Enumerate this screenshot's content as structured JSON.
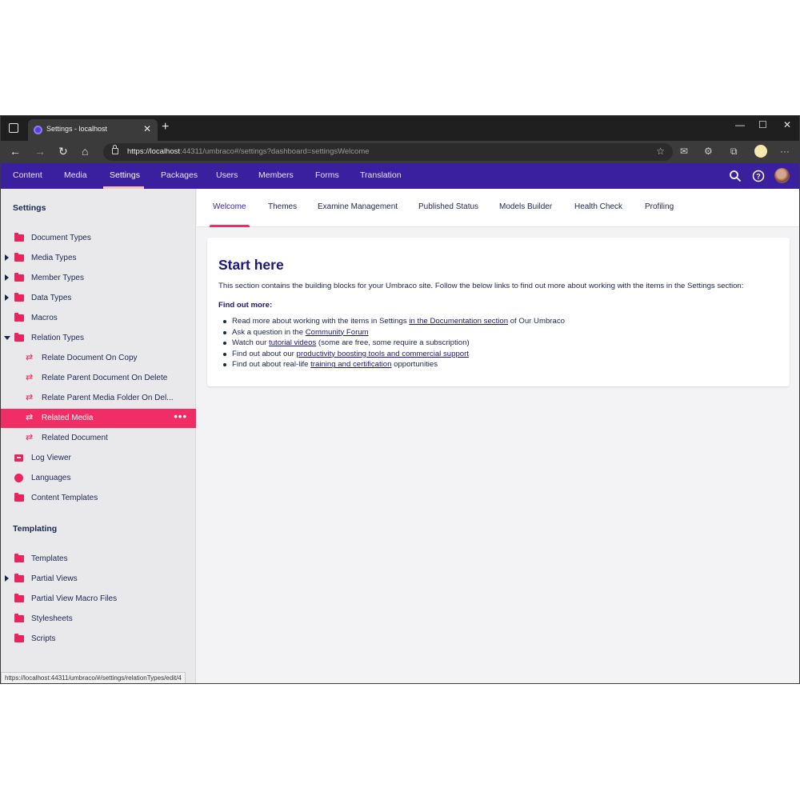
{
  "browser": {
    "tab_title": "Settings - localhost",
    "url_prefix": "https://",
    "url_host": "localhost",
    "url_rest": ":44311/umbraco#/settings?dashboard=settingsWelcome",
    "status_url": "https://localhost:44311/umbraco/#/settings/relationTypes/edit/4"
  },
  "header": {
    "sections": [
      "Content",
      "Media",
      "Settings",
      "Packages",
      "Users",
      "Members",
      "Forms",
      "Translation"
    ],
    "active_section": "Settings",
    "brand_color": "#3a1f9e"
  },
  "sidebar": {
    "settings_heading": "Settings",
    "settings_items": [
      {
        "label": "Document Types",
        "icon": "folder-icon"
      },
      {
        "label": "Media Types",
        "icon": "folder-icon"
      },
      {
        "label": "Member Types",
        "icon": "folder-icon"
      },
      {
        "label": "Data Types",
        "icon": "folder-icon"
      },
      {
        "label": "Macros",
        "icon": "folder-icon"
      },
      {
        "label": "Relation Types",
        "icon": "folder-icon"
      },
      {
        "label": "Relate Document On Copy",
        "icon": "relation-icon"
      },
      {
        "label": "Relate Parent Document On Delete",
        "icon": "relation-icon"
      },
      {
        "label": "Relate Parent Media Folder On Del...",
        "icon": "relation-icon"
      },
      {
        "label": "Related Media",
        "icon": "relation-icon"
      },
      {
        "label": "Related Document",
        "icon": "relation-icon"
      },
      {
        "label": "Log Viewer",
        "icon": "box-icon"
      },
      {
        "label": "Languages",
        "icon": "globe-icon"
      },
      {
        "label": "Content Templates",
        "icon": "folder-icon"
      }
    ],
    "templating_heading": "Templating",
    "templating_items": [
      {
        "label": "Templates",
        "icon": "folder-icon"
      },
      {
        "label": "Partial Views",
        "icon": "folder-icon"
      },
      {
        "label": "Partial View Macro Files",
        "icon": "folder-icon"
      },
      {
        "label": "Stylesheets",
        "icon": "folder-icon"
      },
      {
        "label": "Scripts",
        "icon": "folder-icon"
      }
    ],
    "selected_item": "Related Media",
    "accent_color": "#f02e65"
  },
  "dashboard_tabs": [
    "Welcome",
    "Themes",
    "Examine Management",
    "Published Status",
    "Models Builder",
    "Health Check",
    "Profiling"
  ],
  "active_dashboard_tab": "Welcome",
  "welcome": {
    "title": "Start here",
    "intro": "This section contains the building blocks for your Umbraco site. Follow the below links to find out more about working with the items in the Settings section:",
    "find_out_more": "Find out more:",
    "items": [
      {
        "before": "Read more about working with the items in Settings ",
        "link": "in the Documentation section",
        "after": " of Our Umbraco"
      },
      {
        "before": "Ask a question in the ",
        "link": "Community Forum",
        "after": ""
      },
      {
        "before": "Watch our ",
        "link": "tutorial videos",
        "after": " (some are free, some require a subscription)"
      },
      {
        "before": "Find out about our ",
        "link": "productivity boosting tools and commercial support",
        "after": ""
      },
      {
        "before": "Find out about real-life ",
        "link": "training and certification",
        "after": " opportunities"
      }
    ]
  }
}
